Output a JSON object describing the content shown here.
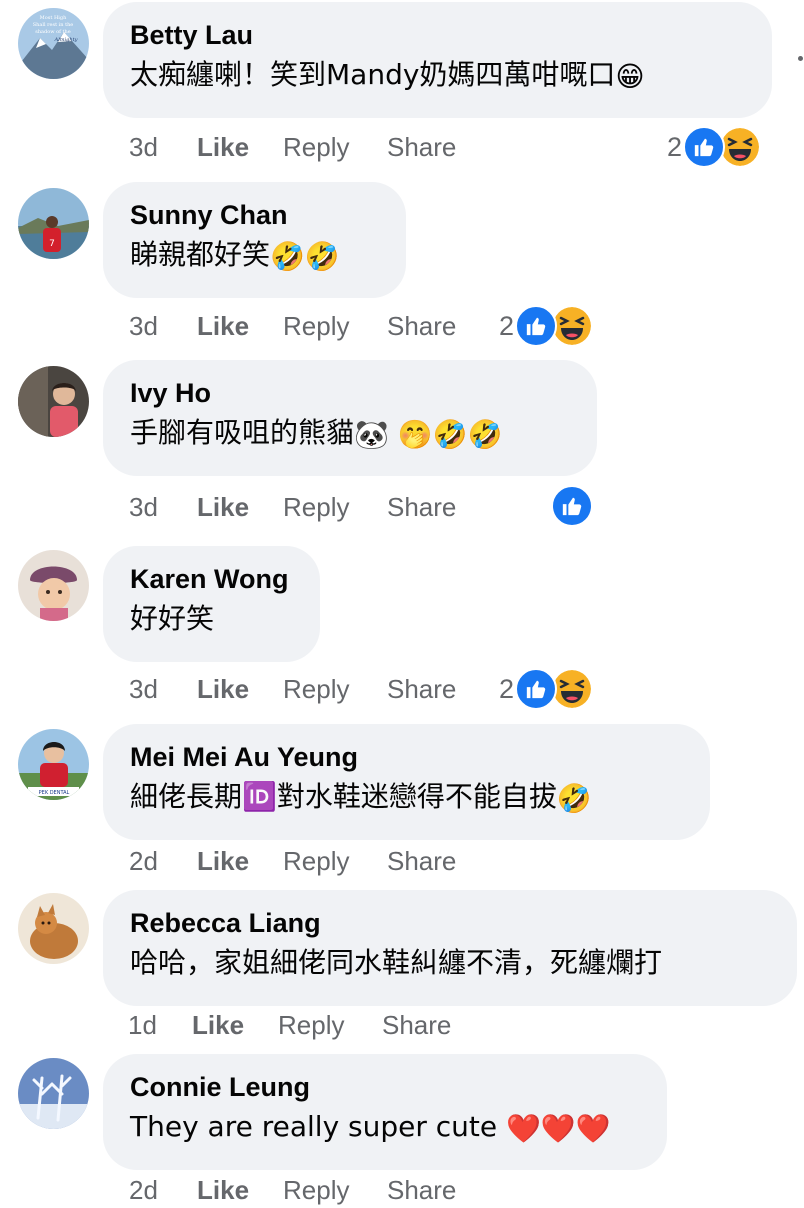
{
  "colors": {
    "bubble": "#f0f2f5",
    "meta_text": "#65676b",
    "like_blue": "#1877f2",
    "haha_yellow": "#f7b125"
  },
  "actions": {
    "like": "Like",
    "reply": "Reply",
    "share": "Share"
  },
  "comments": [
    {
      "author": "Betty Lau",
      "text": "太痴纏喇！笑到Mandy奶媽四萬咁嘅口",
      "emoji": "😁",
      "time": "3d",
      "reaction_count": "2",
      "reactions": [
        "like-icon",
        "haha-icon"
      ]
    },
    {
      "author": "Sunny Chan",
      "text": "睇親都好笑",
      "emoji": "🤣🤣",
      "time": "3d",
      "reaction_count": "2",
      "reactions": [
        "like-icon",
        "haha-icon"
      ]
    },
    {
      "author": "Ivy Ho",
      "text": "手腳有吸咀的熊貓",
      "emoji": "🐼 🤭🤣🤣",
      "time": "3d",
      "reaction_count": "",
      "reactions": [
        "like-icon"
      ]
    },
    {
      "author": "Karen Wong",
      "text": "好好笑",
      "emoji": "",
      "time": "3d",
      "reaction_count": "2",
      "reactions": [
        "like-icon",
        "haha-icon"
      ]
    },
    {
      "author": "Mei Mei Au Yeung",
      "text": "細佬長期🆔對水鞋迷戀得不能自拔",
      "emoji": "🤣",
      "time": "2d",
      "reaction_count": "",
      "reactions": []
    },
    {
      "author": "Rebecca Liang",
      "text": "哈哈，家姐細佬同水鞋糾纏不清，死纏爛打",
      "emoji": "",
      "time": "1d",
      "reaction_count": "",
      "reactions": []
    },
    {
      "author": "Connie Leung",
      "text": "They are really super cute",
      "emoji": "❤️❤️❤️",
      "time": "2d",
      "reaction_count": "",
      "reactions": []
    }
  ],
  "avatar_badge": {
    "line1": "Most High",
    "line2": "Shall rest in the",
    "line3": "shadow of the",
    "line4": "Almighty",
    "jersey_number": "7",
    "sign_text": "PEK DENTAL"
  }
}
